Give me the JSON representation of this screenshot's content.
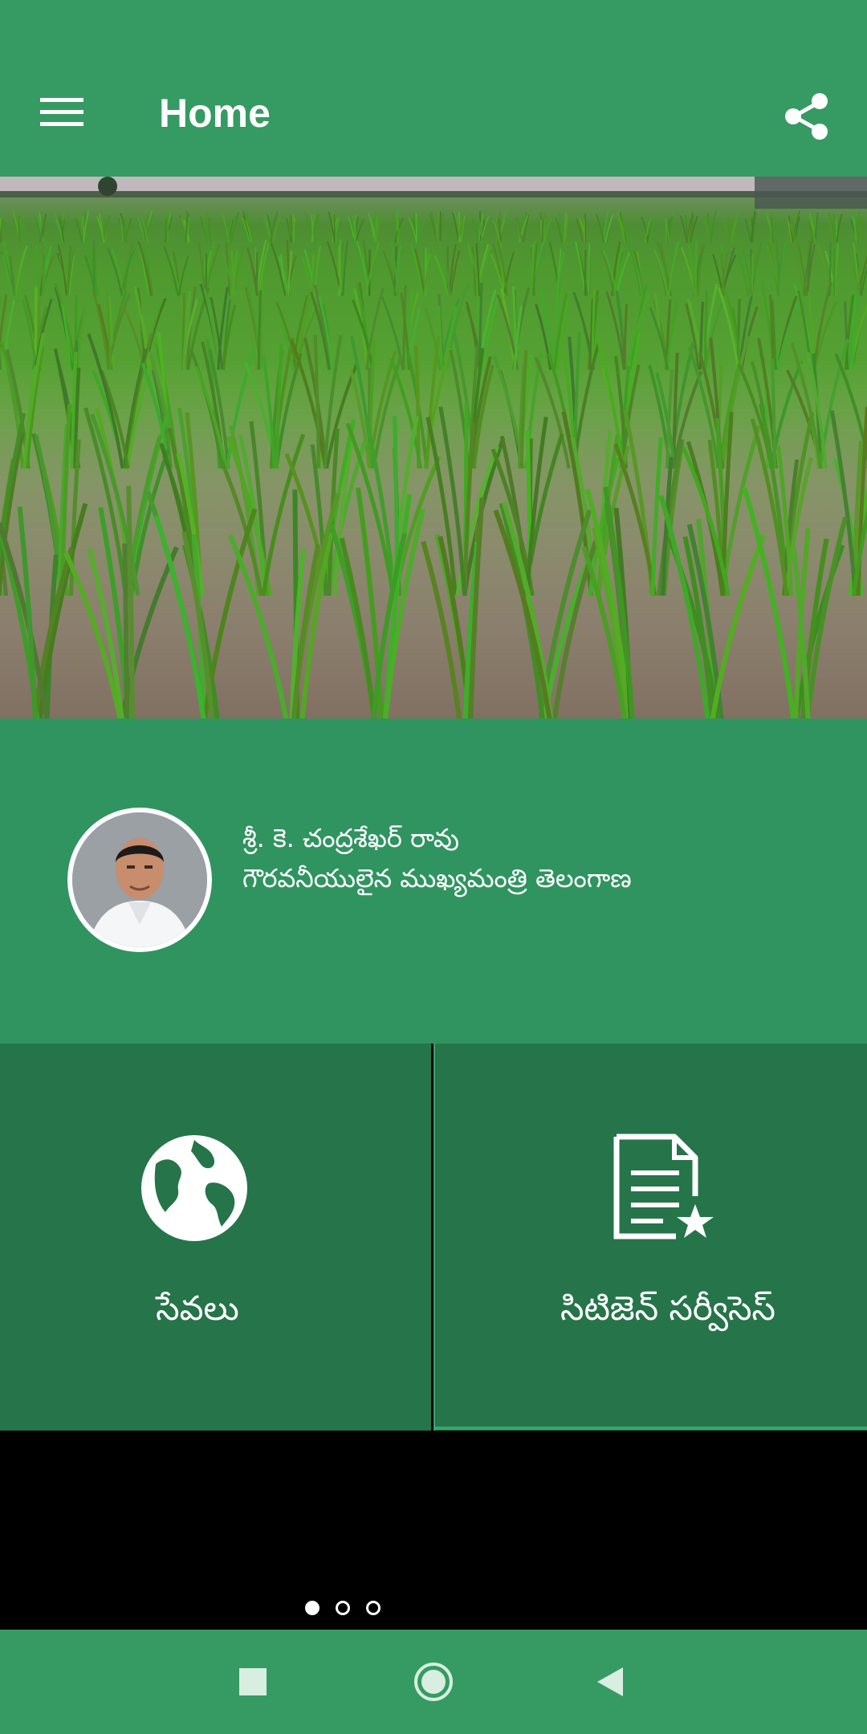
{
  "app_bar": {
    "title": "Home",
    "menu_icon": "hamburger-menu-icon",
    "share_icon": "share-icon"
  },
  "banner": {
    "image": "rice-paddy-field"
  },
  "cm_panel": {
    "name": "శ్రీ. కె. చంద్రశేఖర్ రావు",
    "designation": "గౌరవనీయులైన ముఖ్యమంత్రి తెలంగాణ"
  },
  "tiles": [
    {
      "label": "సేవలు",
      "icon": "globe-icon"
    },
    {
      "label": "సిటిజెన్ సర్వీసెస్",
      "icon": "document-star-icon"
    }
  ],
  "carousel": {
    "dots": 3,
    "active_index": 0
  },
  "nav_bar": {
    "recents_icon": "square-icon",
    "home_icon": "circle-home-icon",
    "back_icon": "triangle-back-icon"
  },
  "colors": {
    "primary": "#359B62",
    "panel": "#2F9460",
    "tile": "#26744A"
  }
}
